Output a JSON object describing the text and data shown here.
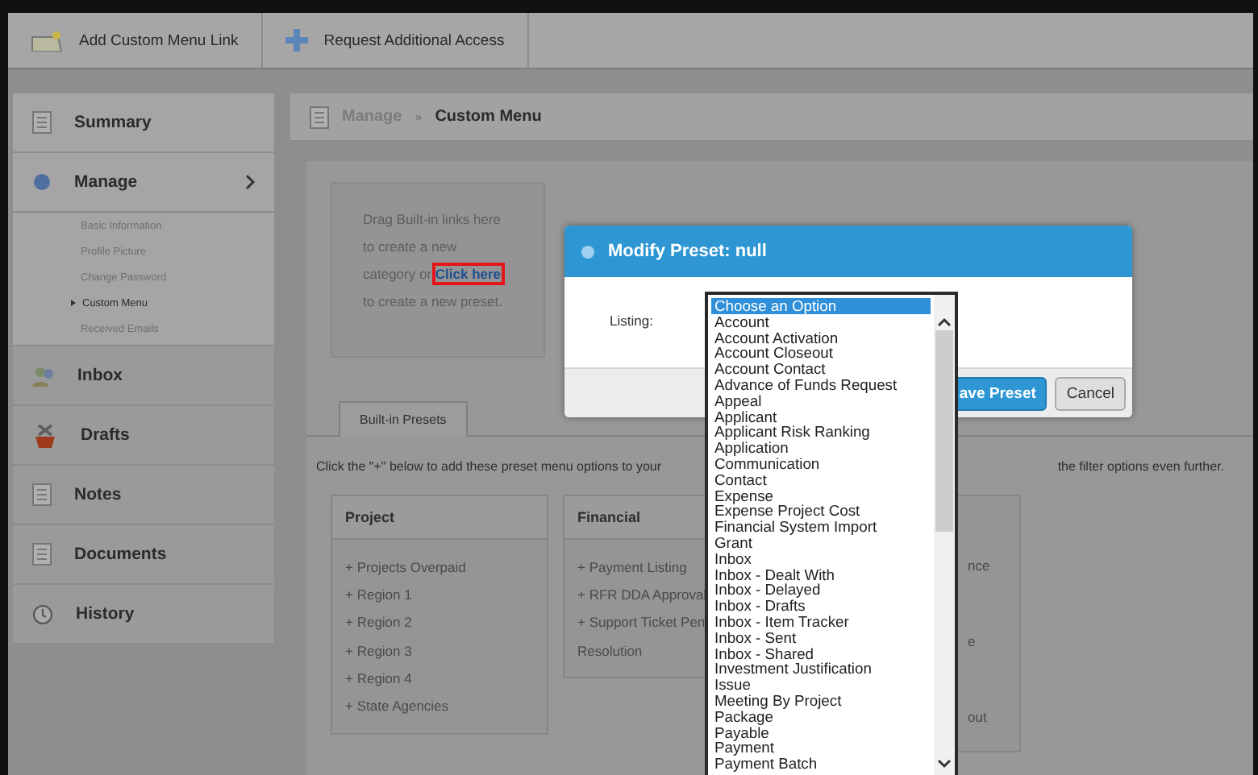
{
  "toolbar": {
    "buttons": [
      {
        "label": "Add Custom Menu Link"
      },
      {
        "label": "Request Additional Access"
      }
    ]
  },
  "sidebar": {
    "items": [
      {
        "label": "Summary",
        "expanded": false
      },
      {
        "label": "Manage",
        "expanded": true,
        "children": [
          {
            "label": "Basic Information",
            "selected": false
          },
          {
            "label": "Profile Picture",
            "selected": false
          },
          {
            "label": "Change Password",
            "selected": false
          },
          {
            "label": "Custom Menu",
            "selected": true
          },
          {
            "label": "Received Emails",
            "selected": false
          }
        ]
      },
      {
        "label": "Inbox",
        "expanded": false
      },
      {
        "label": "Drafts",
        "expanded": false
      },
      {
        "label": "Notes",
        "expanded": false
      },
      {
        "label": "Documents",
        "expanded": false
      },
      {
        "label": "History",
        "expanded": false
      }
    ]
  },
  "breadcrumb": {
    "parent": "Manage",
    "separator": "»",
    "current": "Custom Menu"
  },
  "drag_hint": {
    "before": "Drag Built-in links here to create a new category or",
    "link": "Click here",
    "after": "to create a new preset.",
    "link_highlighted": true
  },
  "tabs": [
    {
      "label": "Built-in Presets",
      "selected": true
    }
  ],
  "instruction_parts": [
    "Click the \"+\" below to add these preset menu options to your",
    "the filter options even further."
  ],
  "preset_columns": [
    {
      "title": "Project",
      "items": [
        "+ Projects Overpaid",
        "+ Region 1",
        "+ Region 2",
        "+ Region 3",
        "+ Region 4",
        "+ State Agencies"
      ]
    },
    {
      "title": "Financial",
      "items": [
        "+ Payment Listing",
        "+ RFR DDA Approval",
        "+ Support Ticket Pen",
        "Resolution"
      ]
    },
    {
      "items": [
        "nce",
        "e",
        "out"
      ]
    }
  ],
  "modal": {
    "title": "Modify Preset: null",
    "field_label": "Listing:",
    "buttons": [
      {
        "label": "ave Preset",
        "primary": true
      },
      {
        "label": "Cancel",
        "primary": false
      }
    ]
  },
  "dropdown": {
    "options": [
      {
        "label": "Choose an Option",
        "selected": true
      },
      {
        "label": "Account",
        "selected": false
      },
      {
        "label": "Account Activation",
        "selected": false
      },
      {
        "label": "Account Closeout",
        "selected": false
      },
      {
        "label": "Account Contact",
        "selected": false
      },
      {
        "label": "Advance of Funds Request",
        "selected": false
      },
      {
        "label": "Appeal",
        "selected": false
      },
      {
        "label": "Applicant",
        "selected": false
      },
      {
        "label": "Applicant Risk Ranking",
        "selected": false
      },
      {
        "label": "Application",
        "selected": false
      },
      {
        "label": "Communication",
        "selected": false
      },
      {
        "label": "Contact",
        "selected": false
      },
      {
        "label": "Expense",
        "selected": false
      },
      {
        "label": "Expense Project Cost",
        "selected": false
      },
      {
        "label": "Financial System Import",
        "selected": false
      },
      {
        "label": "Grant",
        "selected": false
      },
      {
        "label": "Inbox",
        "selected": false
      },
      {
        "label": "Inbox - Dealt With",
        "selected": false
      },
      {
        "label": "Inbox - Delayed",
        "selected": false
      },
      {
        "label": "Inbox - Drafts",
        "selected": false
      },
      {
        "label": "Inbox - Item Tracker",
        "selected": false
      },
      {
        "label": "Inbox - Sent",
        "selected": false
      },
      {
        "label": "Inbox - Shared",
        "selected": false
      },
      {
        "label": "Investment Justification",
        "selected": false
      },
      {
        "label": "Issue",
        "selected": false
      },
      {
        "label": "Meeting By Project",
        "selected": false
      },
      {
        "label": "Package",
        "selected": false
      },
      {
        "label": "Payable",
        "selected": false
      },
      {
        "label": "Payment",
        "selected": false
      },
      {
        "label": "Payment Batch",
        "selected": false
      }
    ]
  }
}
